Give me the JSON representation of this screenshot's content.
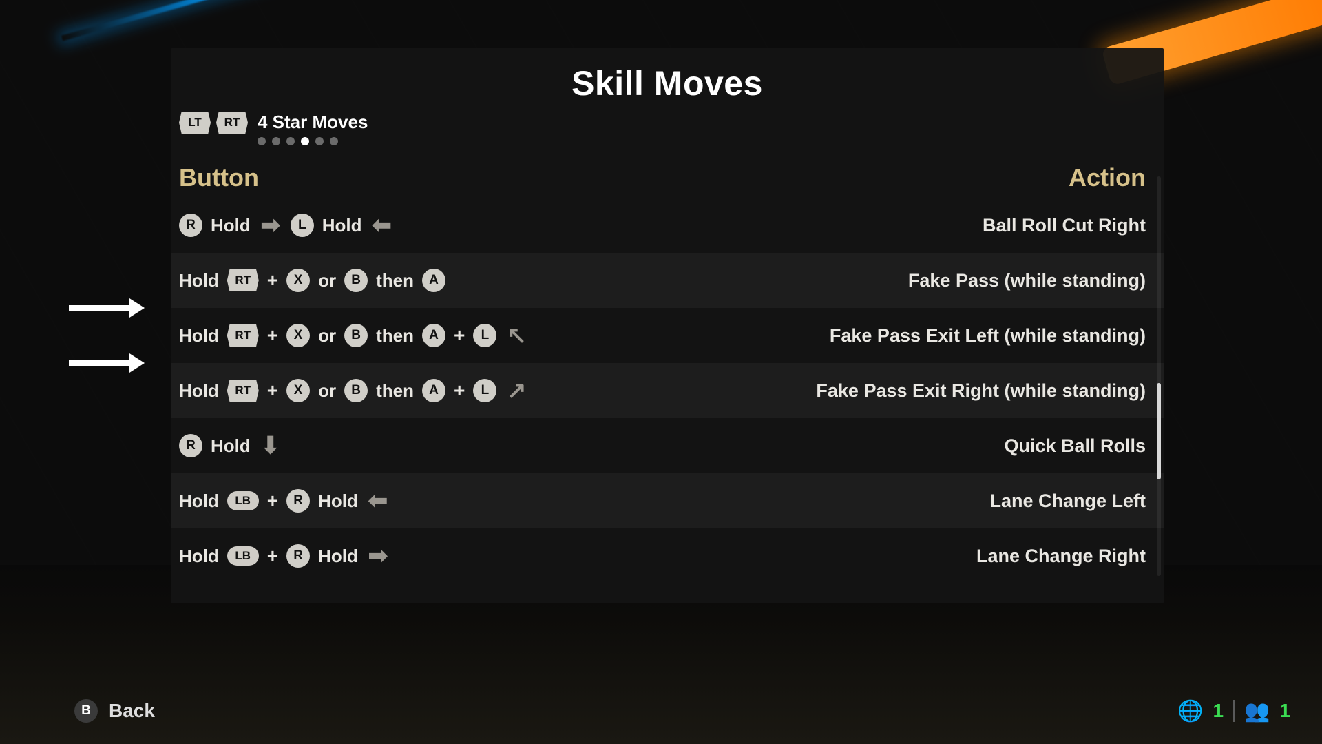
{
  "title": "Skill Moves",
  "subtitle": "4 Star Moves",
  "pagination": {
    "count": 6,
    "active_index": 3
  },
  "columns": {
    "button": "Button",
    "action": "Action"
  },
  "glyphs": {
    "LT": "LT",
    "RT": "RT",
    "LB": "LB",
    "R": "R",
    "L": "L",
    "A": "A",
    "B": "B",
    "X": "X"
  },
  "words": {
    "hold": "Hold",
    "or": "or",
    "then": "then",
    "plus": "+"
  },
  "rows": [
    {
      "action": "Ball Roll Cut Right"
    },
    {
      "action": "Fake Pass (while standing)"
    },
    {
      "action": "Fake Pass Exit Left (while standing)"
    },
    {
      "action": "Fake Pass Exit Right (while standing)"
    },
    {
      "action": "Quick Ball Rolls"
    },
    {
      "action": "Lane Change Left"
    },
    {
      "action": "Lane Change Right"
    }
  ],
  "footer": {
    "back_label": "Back",
    "back_button": "B",
    "players_local": 1,
    "players_party": 1
  }
}
